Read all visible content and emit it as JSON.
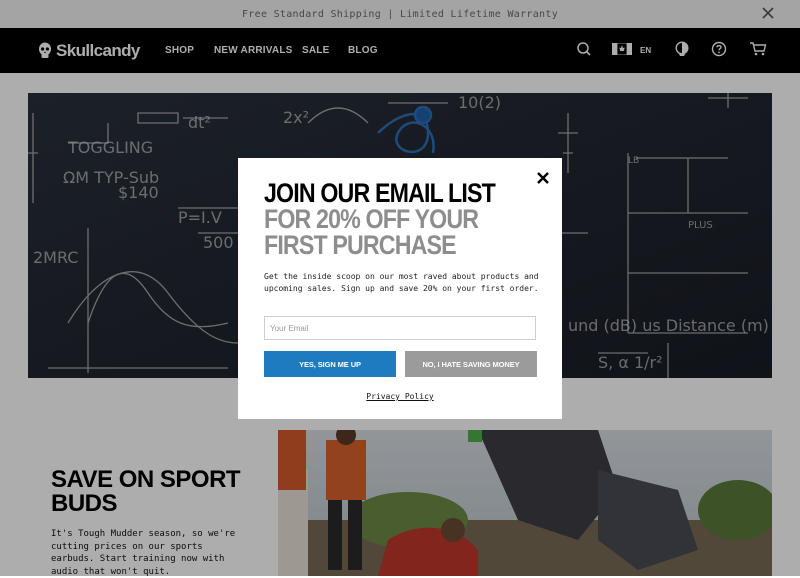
{
  "announcement": {
    "text": "Free Standard Shipping | Limited Lifetime Warranty"
  },
  "header": {
    "logo_text": "Skullcandy",
    "nav": [
      "SHOP",
      "NEW ARRIVALS",
      "SALE",
      "BLOG"
    ],
    "language": "EN",
    "icons": [
      "search-icon",
      "canada-flag-icon",
      "account-icon",
      "help-icon",
      "cart-icon"
    ]
  },
  "promo": {
    "title": "SAVE ON SPORT BUDS",
    "text": "It's Tough Mudder season, so we're cutting prices on our sports earbuds. Start training now with audio that won't quit."
  },
  "modal": {
    "headline": "JOIN OUR EMAIL LIST",
    "subhead_line1": "FOR 20% OFF YOUR",
    "subhead_line2": "FIRST PURCHASE",
    "body": "Get the inside scoop on our most raved about products and upcoming sales. Sign up and save 20% on your first order.",
    "email_placeholder": "Your Email",
    "yes_label": "YES, SIGN ME UP",
    "no_label": "NO, I HATE SAVING MONEY",
    "privacy_label": "Privacy Policy"
  },
  "colors": {
    "accent": "#1e7bbf",
    "secondary_button": "#9b9b9b",
    "nav_bg": "#000000"
  }
}
